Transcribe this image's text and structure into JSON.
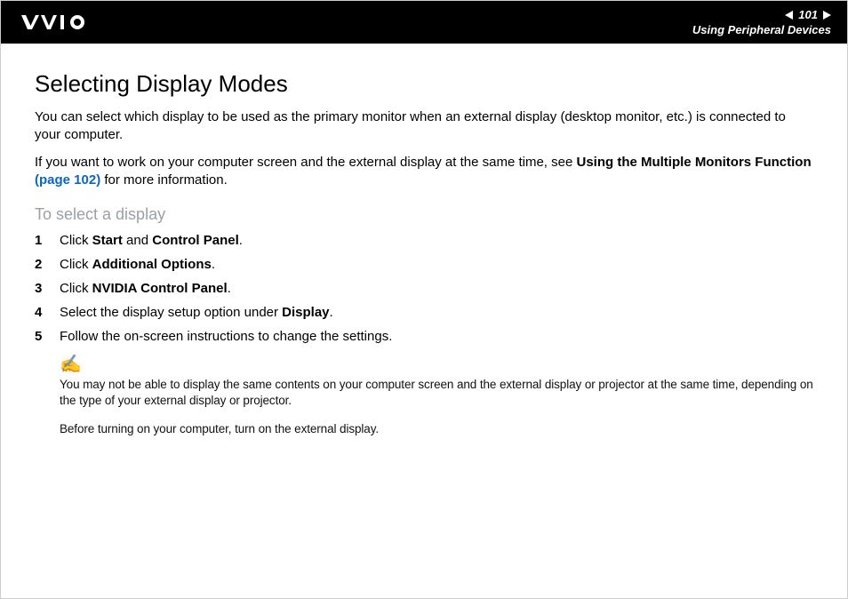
{
  "header": {
    "page_number": "101",
    "section": "Using Peripheral Devices"
  },
  "title": "Selecting Display Modes",
  "intro": {
    "p1": "You can select which display to be used as the primary monitor when an external display (desktop monitor, etc.) is connected to your computer.",
    "p2_a": "If you want to work on your computer screen and the external display at the same time, see ",
    "p2_bold": "Using the Multiple Monitors Function ",
    "p2_link": "(page 102)",
    "p2_c": " for more information."
  },
  "subhead": "To select a display",
  "steps": [
    {
      "num": "1",
      "pre": "Click ",
      "b1": "Start",
      "mid": " and ",
      "b2": "Control Panel",
      "post": "."
    },
    {
      "num": "2",
      "pre": "Click ",
      "b1": "Additional Options",
      "mid": "",
      "b2": "",
      "post": "."
    },
    {
      "num": "3",
      "pre": "Click ",
      "b1": "NVIDIA Control Panel",
      "mid": "",
      "b2": "",
      "post": "."
    },
    {
      "num": "4",
      "pre": "Select the display setup option under ",
      "b1": "Display",
      "mid": "",
      "b2": "",
      "post": "."
    },
    {
      "num": "5",
      "pre": "Follow the on-screen instructions to change the settings.",
      "b1": "",
      "mid": "",
      "b2": "",
      "post": ""
    }
  ],
  "notes": {
    "icon": "✍",
    "n1": "You may not be able to display the same contents on your computer screen and the external display or projector at the same time, depending on the type of your external display or projector.",
    "n2": "Before turning on your computer, turn on the external display."
  }
}
